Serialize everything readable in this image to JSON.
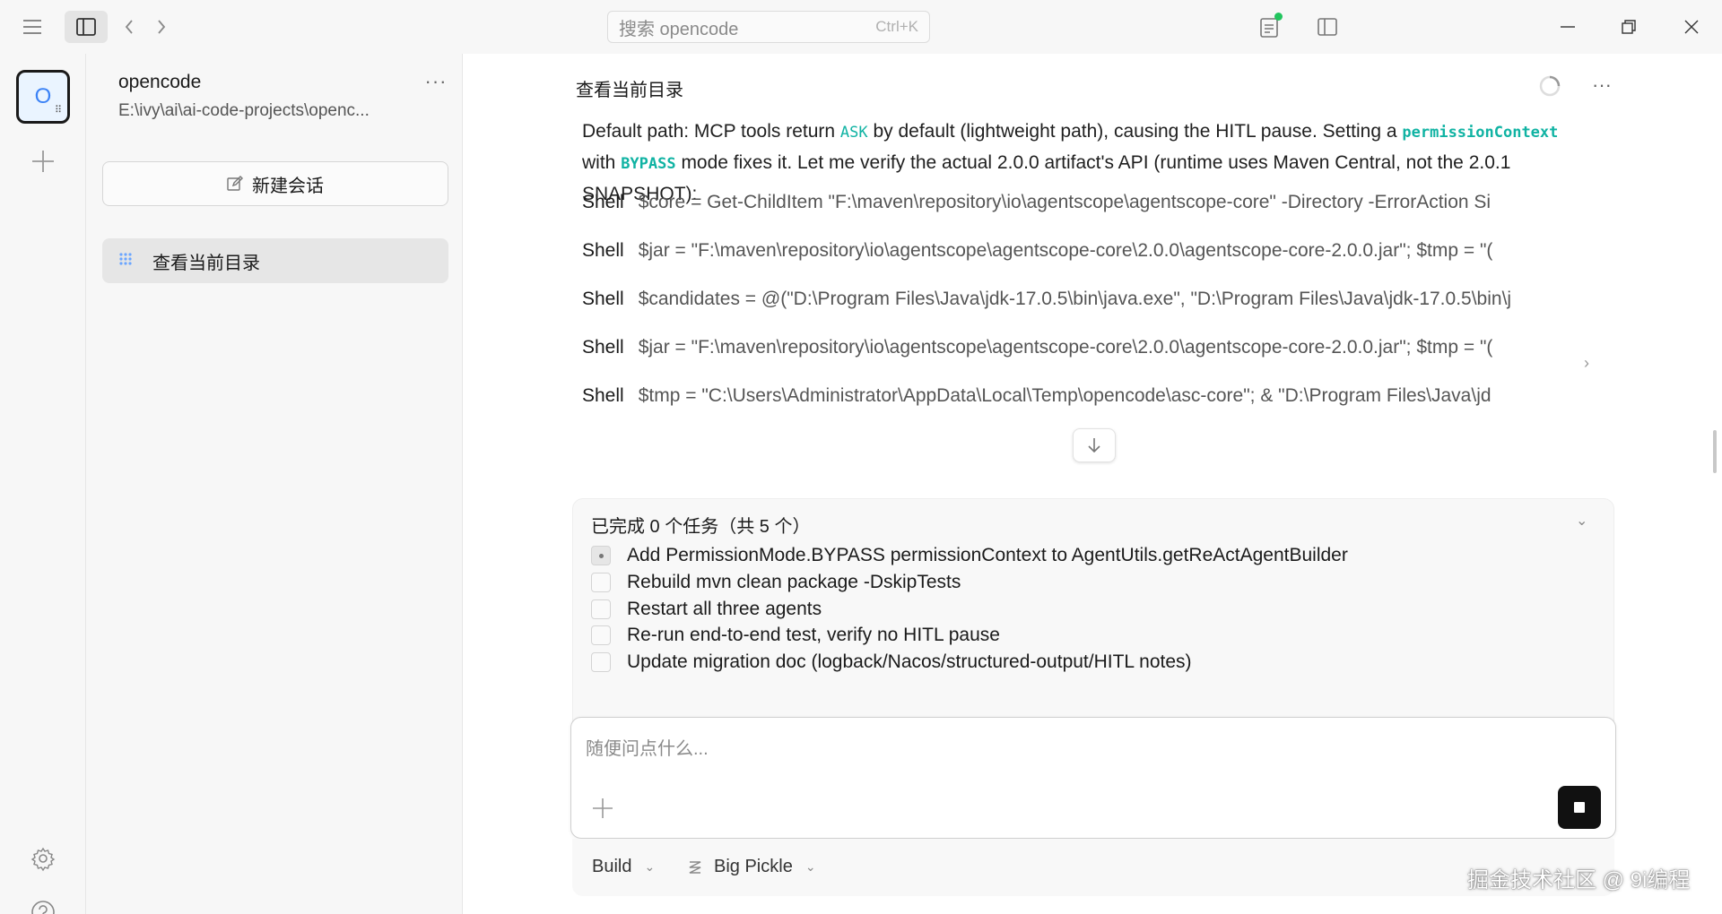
{
  "titlebar": {
    "search_placeholder": "搜索 opencode",
    "search_shortcut": "Ctrl+K"
  },
  "rail": {
    "project_initial": "O"
  },
  "sidebar": {
    "project_name": "opencode",
    "project_path": "E:\\ivy\\ai\\ai-code-projects\\openc...",
    "new_session_label": "新建会话",
    "sessions": [
      {
        "label": "查看当前目录"
      }
    ]
  },
  "conversation": {
    "title": "查看当前目录",
    "message": {
      "part1": "Default path: MCP tools return ",
      "tok_ask": "ASK",
      "part2": " by default (lightweight path), causing the HITL pause. Setting a ",
      "tok_permission": "permissionContext",
      "part3": " with ",
      "tok_bypass": "BYPASS",
      "part4": " mode fixes it. Let me verify the actual 2.0.0 artifact's API (runtime uses Maven Central, not the 2.0.1 SNAPSHOT):"
    },
    "shell_label": "Shell",
    "shell_commands": [
      "$core = Get-ChildItem \"F:\\maven\\repository\\io\\agentscope\\agentscope-core\" -Directory -ErrorAction Si",
      "$jar = \"F:\\maven\\repository\\io\\agentscope\\agentscope-core\\2.0.0\\agentscope-core-2.0.0.jar\"; $tmp = \"(",
      "$candidates = @(\"D:\\Program Files\\Java\\jdk-17.0.5\\bin\\java.exe\", \"D:\\Program Files\\Java\\jdk-17.0.5\\bin\\j",
      "$jar = \"F:\\maven\\repository\\io\\agentscope\\agentscope-core\\2.0.0\\agentscope-core-2.0.0.jar\"; $tmp = \"(",
      "$tmp = \"C:\\Users\\Administrator\\AppData\\Local\\Temp\\opencode\\asc-core\"; & \"D:\\Program Files\\Java\\jd"
    ]
  },
  "tasks": {
    "header": "已完成 0 个任务（共 5 个）",
    "items": [
      {
        "label": "Add PermissionMode.BYPASS permissionContext to AgentUtils.getReActAgentBuilder",
        "state": "in-progress"
      },
      {
        "label": "Rebuild mvn clean package -DskipTests",
        "state": "pending"
      },
      {
        "label": "Restart all three agents",
        "state": "pending"
      },
      {
        "label": "Re-run end-to-end test, verify no HITL pause",
        "state": "pending"
      },
      {
        "label": "Update migration doc (logback/Nacos/structured-output/HITL notes)",
        "state": "pending"
      }
    ]
  },
  "composer": {
    "placeholder": "随便问点什么...",
    "mode": "Build",
    "model": "Big Pickle"
  },
  "watermark": "掘金技术社区 @ 9i编程"
}
